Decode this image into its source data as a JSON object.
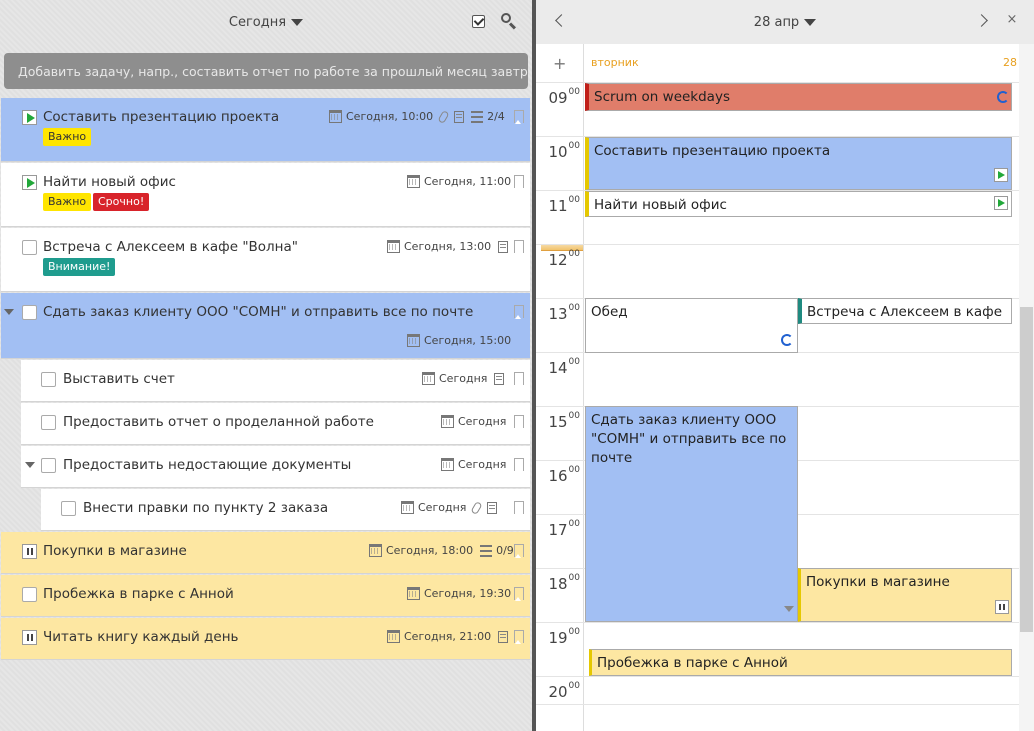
{
  "left_header": {
    "title": "Сегодня"
  },
  "add_task": {
    "placeholder": "Добавить задачу, напр., составить отчет по работе за прошлый месяц завтра..."
  },
  "tasks": [
    {
      "title": "Составить презентацию проекта",
      "date": "Сегодня, 10:00",
      "progress": "2/4",
      "tags": [
        "Важно"
      ]
    },
    {
      "title": "Найти новый офис",
      "date": "Сегодня, 11:00",
      "tags": [
        "Важно",
        "Срочно!"
      ]
    },
    {
      "title": "Встреча с Алексеем в кафе \"Волна\"",
      "date": "Сегодня, 13:00",
      "tags": [
        "Внимание!"
      ]
    },
    {
      "title": "Сдать заказ клиенту ООО \"СОМН\" и отправить все по почте",
      "date": "Сегодня, 15:00"
    },
    {
      "title": "Выставить счет",
      "date": "Сегодня"
    },
    {
      "title": "Предоставить отчет о проделанной работе",
      "date": "Сегодня"
    },
    {
      "title": "Предоставить недостающие документы",
      "date": "Сегодня"
    },
    {
      "title": "Внести правки по пункту 2 заказа",
      "date": "Сегодня"
    },
    {
      "title": "Покупки в магазине",
      "date": "Сегодня, 18:00",
      "progress": "0/9"
    },
    {
      "title": "Пробежка в парке с Анной",
      "date": "Сегодня, 19:30"
    },
    {
      "title": "Читать книгу каждый день",
      "date": "Сегодня, 21:00"
    }
  ],
  "calendar": {
    "date_title": "28 апр",
    "day_name": "вторник",
    "day_number": "28",
    "plus": "+",
    "close": "×",
    "hours": [
      "09",
      "10",
      "11",
      "12",
      "13",
      "14",
      "15",
      "16",
      "17",
      "18",
      "19",
      "20"
    ],
    "minutes": "00",
    "events": [
      {
        "title": "Scrum on weekdays"
      },
      {
        "title": "Составить презентацию проекта"
      },
      {
        "title": "Найти новый офис"
      },
      {
        "title": "Обед"
      },
      {
        "title": "Встреча с Алексеем в кафе"
      },
      {
        "title": "Сдать заказ клиенту ООО \"СОМН\" и отправить все по почте"
      },
      {
        "title": "Покупки в магазине"
      },
      {
        "title": "Пробежка в парке с Анной"
      }
    ]
  },
  "colors": {
    "task_blue": "#a2bff3",
    "task_yellow": "#fde7a2",
    "tag_yellow": "#ffe500",
    "tag_red": "#d8232a",
    "tag_teal": "#1f9c8e",
    "accent_orange": "#e8a020"
  }
}
